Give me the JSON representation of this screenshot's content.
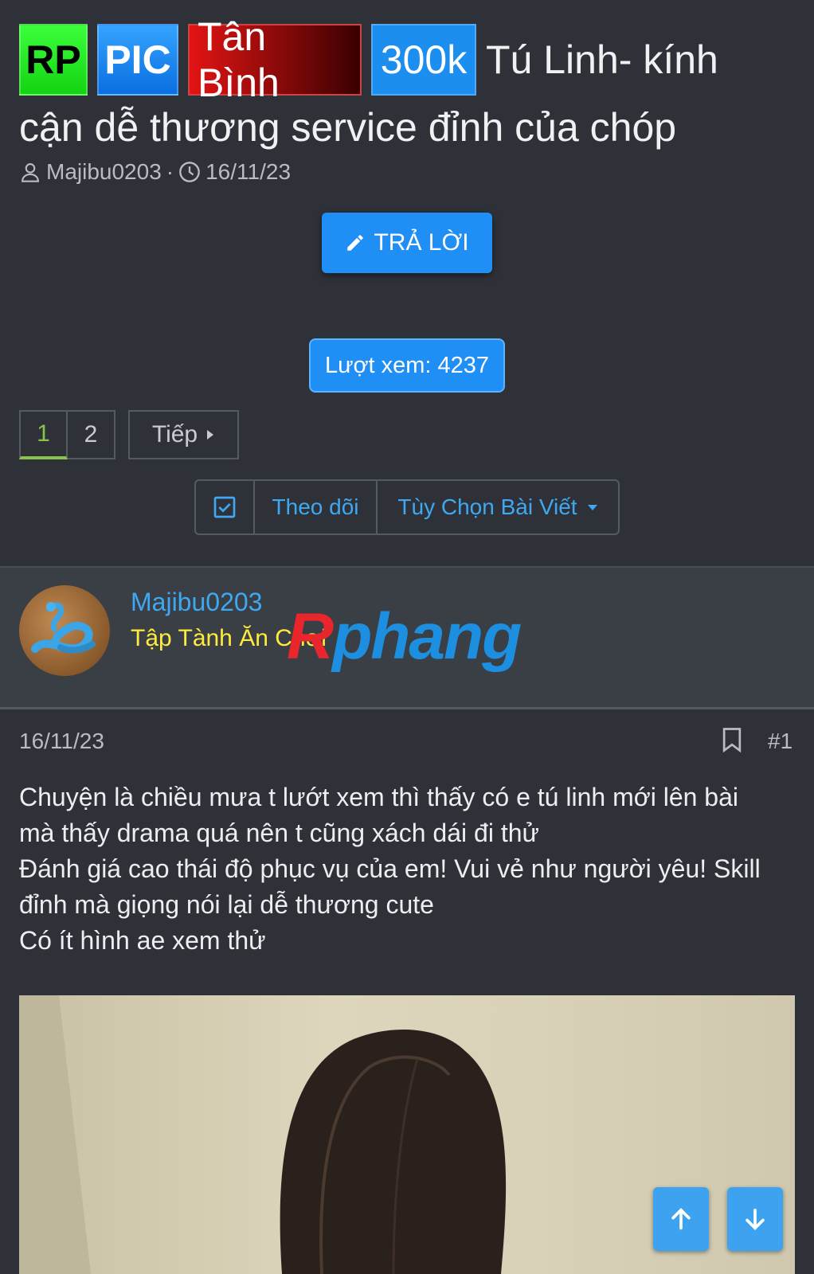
{
  "thread": {
    "prefixes": {
      "rp": "RP",
      "pic": "PIC",
      "area": "Tân Bình",
      "price": "300k"
    },
    "title_line1": "Tú Linh- kính",
    "title_line2": "cận dễ thương service đỉnh của chóp",
    "author": "Majibu0203",
    "meta_sep": "·",
    "date": "16/11/23",
    "colors": {
      "rp": "#22e522",
      "pic": "#1a86f0",
      "area": "#b50000",
      "price": "#1b8ef0"
    }
  },
  "actions": {
    "reply_label": "TRẢ LỜI",
    "views_label": "Lượt xem: 4237"
  },
  "pagination": {
    "pages": [
      "1",
      "2"
    ],
    "current": "1",
    "next_label": "Tiếp"
  },
  "options": {
    "follow_label": "Theo dõi",
    "post_options_label": "Tùy Chọn Bài Viết"
  },
  "user": {
    "name": "Majibu0203",
    "title": "Tập Tành Ăn Chơi"
  },
  "watermark": {
    "part1": "R",
    "part2": "phang"
  },
  "post": {
    "date": "16/11/23",
    "number": "#1",
    "lines": [
      "Chuyện là chiều mưa t lướt xem thì thấy có e tú linh mới lên bài",
      "mà thấy drama quá nên t cũng xách dái đi thử",
      "Đánh giá cao thái độ phục vụ của em! Vui vẻ như người yêu! Skill",
      "đỉnh mà giọng nói lại dễ thương cute",
      "Có ít hình ae xem thử"
    ]
  },
  "icons": {
    "author": "user-icon",
    "date": "clock-icon",
    "reply": "pencil-icon",
    "next": "caret-right-icon",
    "follow": "checkbox-icon",
    "options": "caret-down-icon",
    "bookmark": "bookmark-icon",
    "scroll_up": "arrow-up-icon",
    "scroll_down": "arrow-down-icon"
  }
}
